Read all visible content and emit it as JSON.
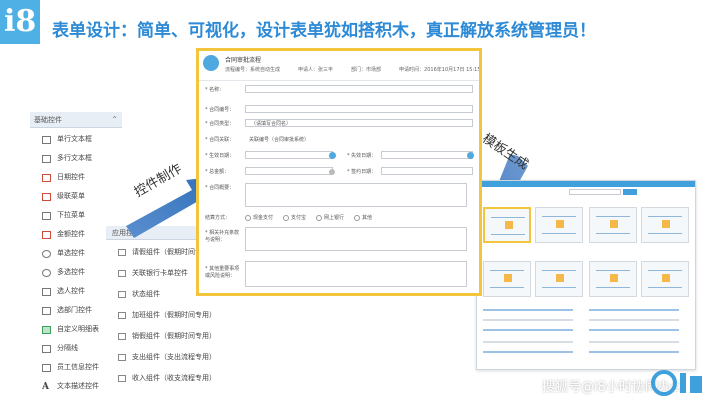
{
  "brand": {
    "logo_text": "i8"
  },
  "headline": "表单设计：简单、可视化，设计表单犹如搭积木，真正解放系统管理员！",
  "palette": {
    "header": "基础控件",
    "items": [
      {
        "label": "单行文本框",
        "icon": "text-line-icon",
        "tone": ""
      },
      {
        "label": "多行文本框",
        "icon": "text-area-icon",
        "tone": ""
      },
      {
        "label": "日期控件",
        "icon": "calendar-icon",
        "tone": "red"
      },
      {
        "label": "级联菜单",
        "icon": "cascade-icon",
        "tone": "red"
      },
      {
        "label": "下拉菜单",
        "icon": "dropdown-icon",
        "tone": ""
      },
      {
        "label": "金额控件",
        "icon": "money-icon",
        "tone": "red"
      },
      {
        "label": "单选控件",
        "icon": "radio-icon",
        "tone": "circle"
      },
      {
        "label": "多选控件",
        "icon": "checkbox-icon",
        "tone": "circle"
      },
      {
        "label": "选人控件",
        "icon": "person-icon",
        "tone": ""
      },
      {
        "label": "选部门控件",
        "icon": "org-icon",
        "tone": ""
      },
      {
        "label": "自定义明细表",
        "icon": "detail-table-icon",
        "tone": "green"
      },
      {
        "label": "分隔线",
        "icon": "divider-icon",
        "tone": ""
      },
      {
        "label": "员工信息控件",
        "icon": "employee-card-icon",
        "tone": ""
      },
      {
        "label": "文本描述控件",
        "icon": "text-icon",
        "tone": "txt"
      }
    ]
  },
  "sub_palette": {
    "header": "应用控件",
    "items": [
      {
        "label": "请假组件（假期时间专用）",
        "icon": "arrow-icon"
      },
      {
        "label": "关联银行卡单控件",
        "icon": "link-icon"
      },
      {
        "label": "状态组件",
        "icon": "status-icon"
      },
      {
        "label": "加班组件（假期时间专用）",
        "icon": "overtime-icon"
      },
      {
        "label": "销假组件（假期时间专用）",
        "icon": "cancel-leave-icon"
      },
      {
        "label": "支出组件（支出流程专用）",
        "icon": "expense-icon"
      },
      {
        "label": "收入组件（收支流程专用）",
        "icon": "income-icon"
      }
    ]
  },
  "arrows": {
    "left_label": "控件制作",
    "right_label": "模板生成"
  },
  "form": {
    "title": "合同审批流程",
    "meta": [
      "流程编号：系统自动生成",
      "申请人：张三丰",
      "部门：市场部",
      "申请时间：2016年10月17日 15:15"
    ],
    "rows": {
      "name": "* 名称：",
      "contract_no": "* 合同编号：",
      "contract_type": "* 合同类型：",
      "contract_type_value": "（请填写合同名）",
      "related": "* 合同关联：",
      "related_value": "关联编号（合同审批系统）",
      "start_date": "* 生效日期：",
      "end_date": "* 失效日期：",
      "amount": "* 总金额：",
      "sign_date": "* 签约日期：",
      "summary": "* 合同概要：",
      "pay_type": "结算方式：",
      "pay_options": [
        "现金支付",
        "支付宝",
        "网上银行",
        "其他"
      ],
      "supplement": "* 相关补充条款与说明：",
      "remark": "* 其他重要事项或风险说明："
    }
  },
  "template_window": {
    "search_placeholder": ""
  },
  "watermark": "搜狐号@i8小时协同办公"
}
